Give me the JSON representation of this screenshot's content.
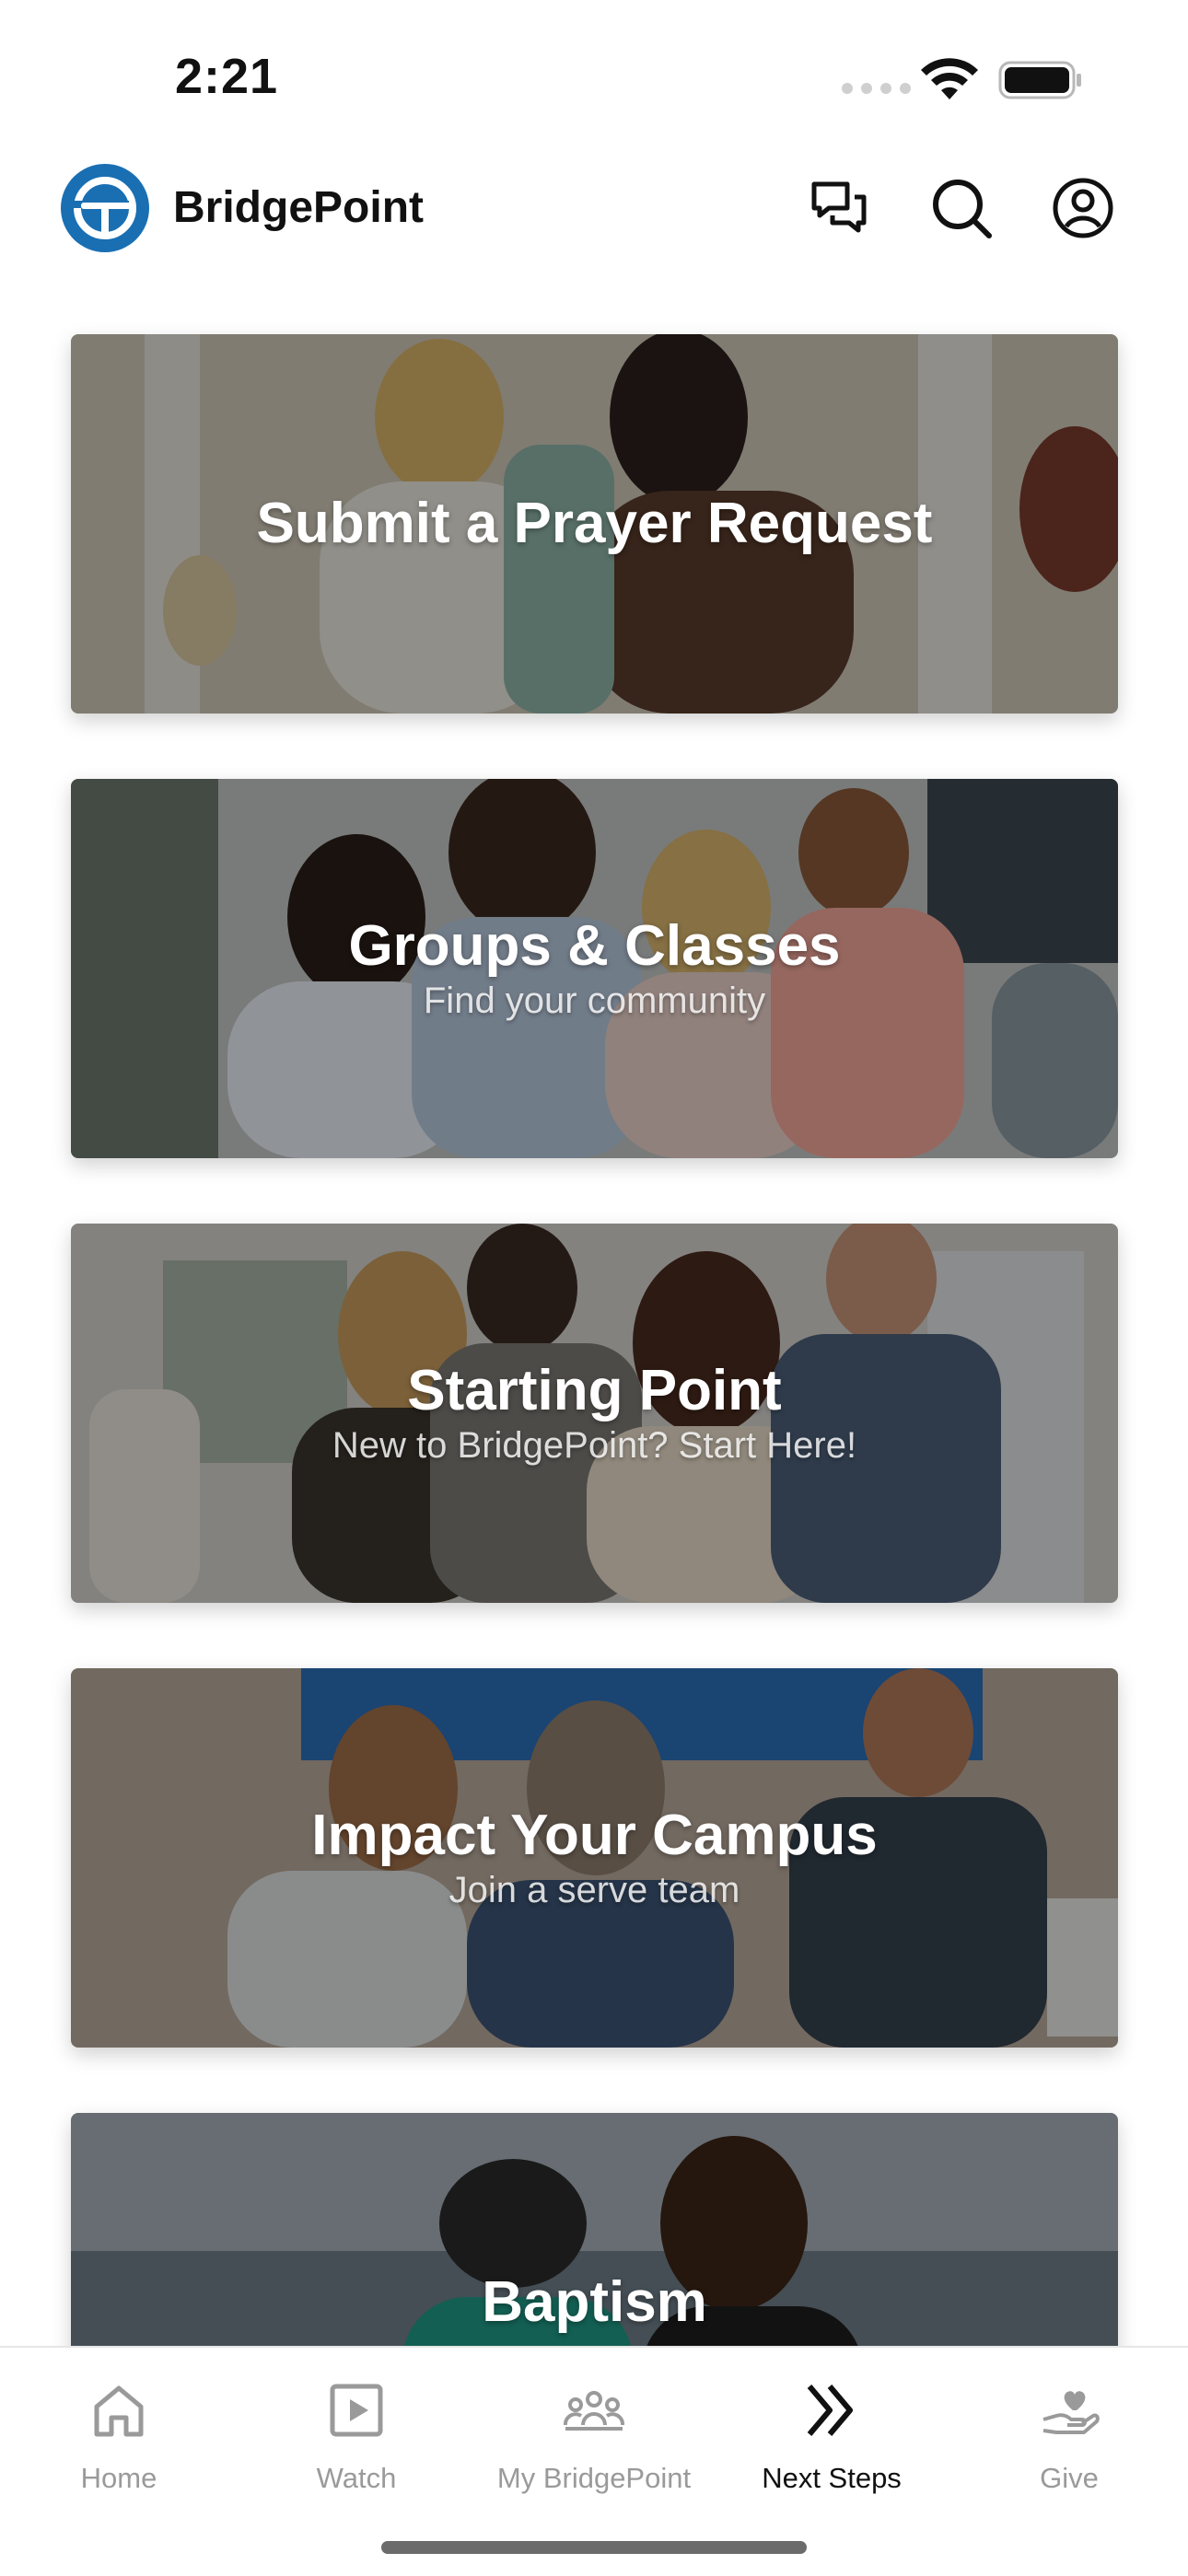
{
  "status_bar": {
    "time": "2:21"
  },
  "header": {
    "title": "BridgePoint"
  },
  "cards": [
    {
      "title": "Submit a Prayer Request",
      "subtitle": ""
    },
    {
      "title": "Groups & Classes",
      "subtitle": "Find your community"
    },
    {
      "title": "Starting Point",
      "subtitle": "New to BridgePoint? Start Here!"
    },
    {
      "title": "Impact Your Campus",
      "subtitle": "Join a serve team"
    },
    {
      "title": "Baptism",
      "subtitle": ""
    }
  ],
  "tab_bar": {
    "items": [
      {
        "label": "Home",
        "icon": "home-icon",
        "active": false
      },
      {
        "label": "Watch",
        "icon": "play-icon",
        "active": false
      },
      {
        "label": "My BridgePoint",
        "icon": "people-icon",
        "active": false
      },
      {
        "label": "Next Steps",
        "icon": "double-chevron-icon",
        "active": true
      },
      {
        "label": "Give",
        "icon": "heart-hand-icon",
        "active": false
      }
    ]
  },
  "colors": {
    "brand": "#1a6fb3",
    "active_tab": "#111111",
    "inactive_tab": "#9a9a9a"
  }
}
